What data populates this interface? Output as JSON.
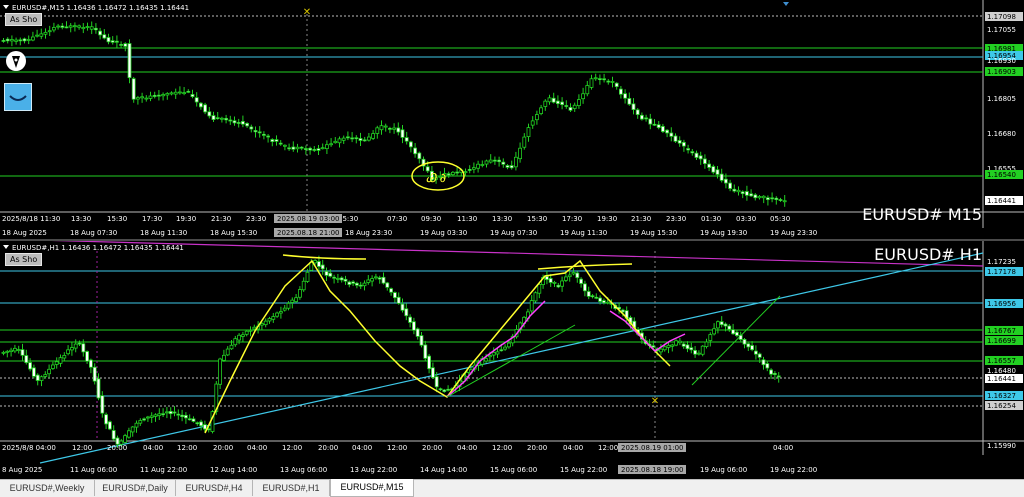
{
  "top_chart": {
    "header": "EURUSD#,M15  1.16436 1.16472 1.16435 1.16441",
    "button_label": "As Sho",
    "symbol_label": "EURUSD# M15",
    "price_axis": [
      "1.17098",
      "1.17055",
      "1.16981",
      "1.16954",
      "1.16930",
      "1.16903",
      "1.16805",
      "1.16680",
      "1.16555",
      "1.16540",
      "1.16441"
    ],
    "time_axis": [
      "2025/8/18 11:30",
      "13:30",
      "15:30",
      "17:30",
      "19:30",
      "21:30",
      "23:30",
      "05:30",
      "07:30",
      "09:30",
      "11:30",
      "13:30",
      "15:30",
      "17:30",
      "19:30",
      "21:30",
      "23:30",
      "01:30",
      "03:30",
      "05:30"
    ],
    "time_axis_2": [
      "18 Aug 2025",
      "18 Aug 07:30",
      "18 Aug 11:30",
      "18 Aug 15:30",
      "18 Aug 23:30",
      "19 Aug 03:30",
      "19 Aug 07:30",
      "19 Aug 11:30",
      "19 Aug 15:30",
      "19 Aug 19:30",
      "19 Aug 23:30"
    ],
    "cursor_time": "2025.08.19 03:00",
    "cursor_time_2": "2025.08.18 21:00",
    "highlight_colors": {
      "green": "#22d022",
      "cyan": "#3ec8e8"
    }
  },
  "bottom_chart": {
    "header": "EURUSD#,H1  1.16436 1.16472 1.16435 1.16441",
    "button_label": "As Sho",
    "symbol_label": "EURUSD# H1",
    "price_axis": [
      "1.17235",
      "1.17178",
      "1.16956",
      "1.16767",
      "1.16699",
      "1.16557",
      "1.16480",
      "1.16441",
      "1.16327",
      "1.16254",
      "1.15990"
    ],
    "time_axis": [
      "2025/8/8 04:00",
      "12:00",
      "20:00",
      "04:00",
      "12:00",
      "20:00",
      "04:00",
      "12:00",
      "20:00",
      "04:00",
      "12:00",
      "20:00",
      "04:00",
      "12:00",
      "20:00",
      "04:00",
      "12:00",
      "20:00",
      "04:00"
    ],
    "time_axis_2": [
      "8 Aug 2025",
      "11 Aug 06:00",
      "11 Aug 22:00",
      "12 Aug 14:00",
      "13 Aug 06:00",
      "13 Aug 22:00",
      "14 Aug 14:00",
      "15 Aug 06:00",
      "15 Aug 22:00",
      "19 Aug 06:00",
      "19 Aug 22:00"
    ],
    "cursor_time": "2025.08.19 01:00",
    "cursor_time_2": "2025.08.18 19:00"
  },
  "tabs": [
    "EURUSD#,Weekly",
    "EURUSD#,Daily",
    "EURUSD#,H4",
    "EURUSD#,H1",
    "EURUSD#,M15"
  ],
  "active_tab": "EURUSD#,M15"
}
